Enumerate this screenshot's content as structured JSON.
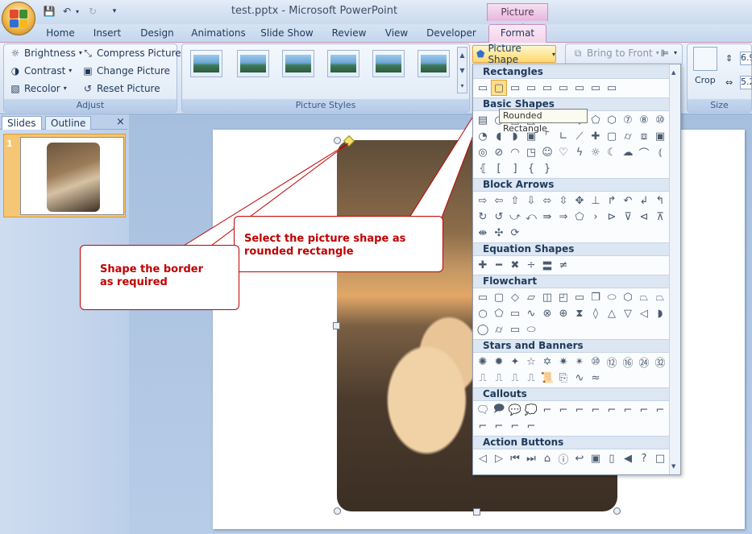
{
  "window": {
    "title": "test.pptx - Microsoft PowerPoint",
    "contextual_tab_group": "Picture Tools"
  },
  "ribbon_tabs": [
    "Home",
    "Insert",
    "Design",
    "Animations",
    "Slide Show",
    "Review",
    "View",
    "Developer",
    "Format"
  ],
  "active_tab": "Format",
  "adjust": {
    "label": "Adjust",
    "brightness": "Brightness",
    "contrast": "Contrast",
    "recolor": "Recolor",
    "compress": "Compress Pictures",
    "change": "Change Picture",
    "reset": "Reset Picture"
  },
  "picture_styles": {
    "label": "Picture Styles"
  },
  "arrange": {
    "picture_shape": "Picture Shape",
    "bring_to_front": "Bring to Front"
  },
  "size": {
    "label": "Size",
    "crop": "Crop",
    "height": "6.9",
    "width": "5.2"
  },
  "left_pane": {
    "tab_slides": "Slides",
    "tab_outline": "Outline",
    "close": "×",
    "slide_number": "1"
  },
  "shape_menu": {
    "categories": [
      "Rectangles",
      "Basic Shapes",
      "Block Arrows",
      "Equation Shapes",
      "Flowchart",
      "Stars and Banners",
      "Callouts",
      "Action Buttons"
    ],
    "tooltip": "Rounded Rectangle"
  },
  "callouts": {
    "left": "Shape the border as required",
    "right": "Select the picture shape as rounded rectangle"
  },
  "colors": {
    "accent_red": "#c00000",
    "format_tab": "#f3d3ea",
    "ribbon_bg": "#dbe6f4"
  }
}
